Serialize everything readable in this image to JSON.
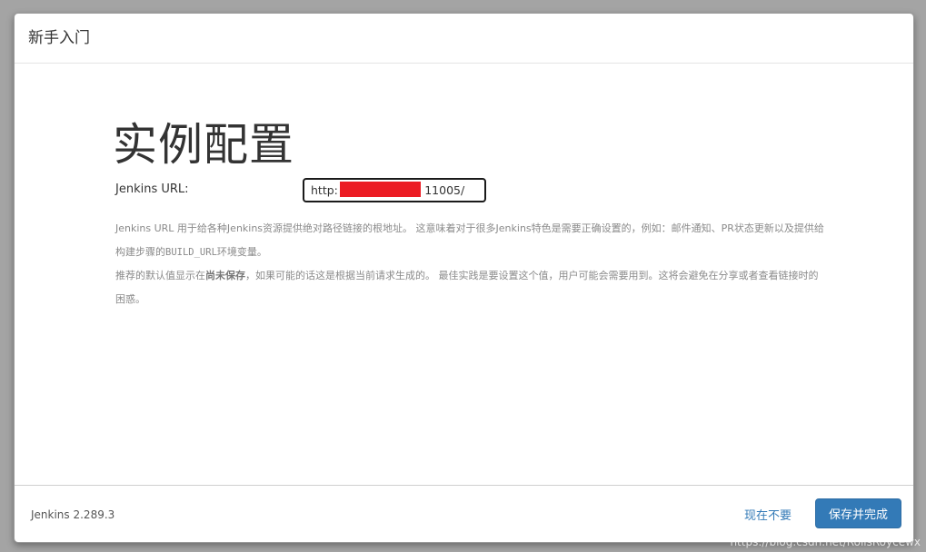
{
  "dialog": {
    "title": "新手入门"
  },
  "main": {
    "heading": "实例配置",
    "url_label": "Jenkins URL:",
    "url_value": "http:                        11005/",
    "help": {
      "p1": "Jenkins URL 用于给各种Jenkins资源提供绝对路径链接的根地址。 这意味着对于很多Jenkins特色是需要正确设置的，例如：邮件通知、PR状态更新以及提供给构建步骤的",
      "p1_env": "BUILD_URL",
      "p1_end": "环境变量。",
      "p2_start": "推荐的默认值显示在",
      "p2_bold": "尚未保存",
      "p2_end": "，如果可能的话这是根据当前请求生成的。 最佳实践是要设置这个值，用户可能会需要用到。这将会避免在分享或者查看链接时的困惑。"
    }
  },
  "footer": {
    "version": "Jenkins 2.289.3",
    "skip_label": "现在不要",
    "save_label": "保存并完成"
  },
  "watermark": "https://blog.csdn.net/RollsRoycewx",
  "colors": {
    "primary": "#337ab7",
    "redaction": "#ec1c24",
    "backdrop": "#a4a4a4"
  }
}
